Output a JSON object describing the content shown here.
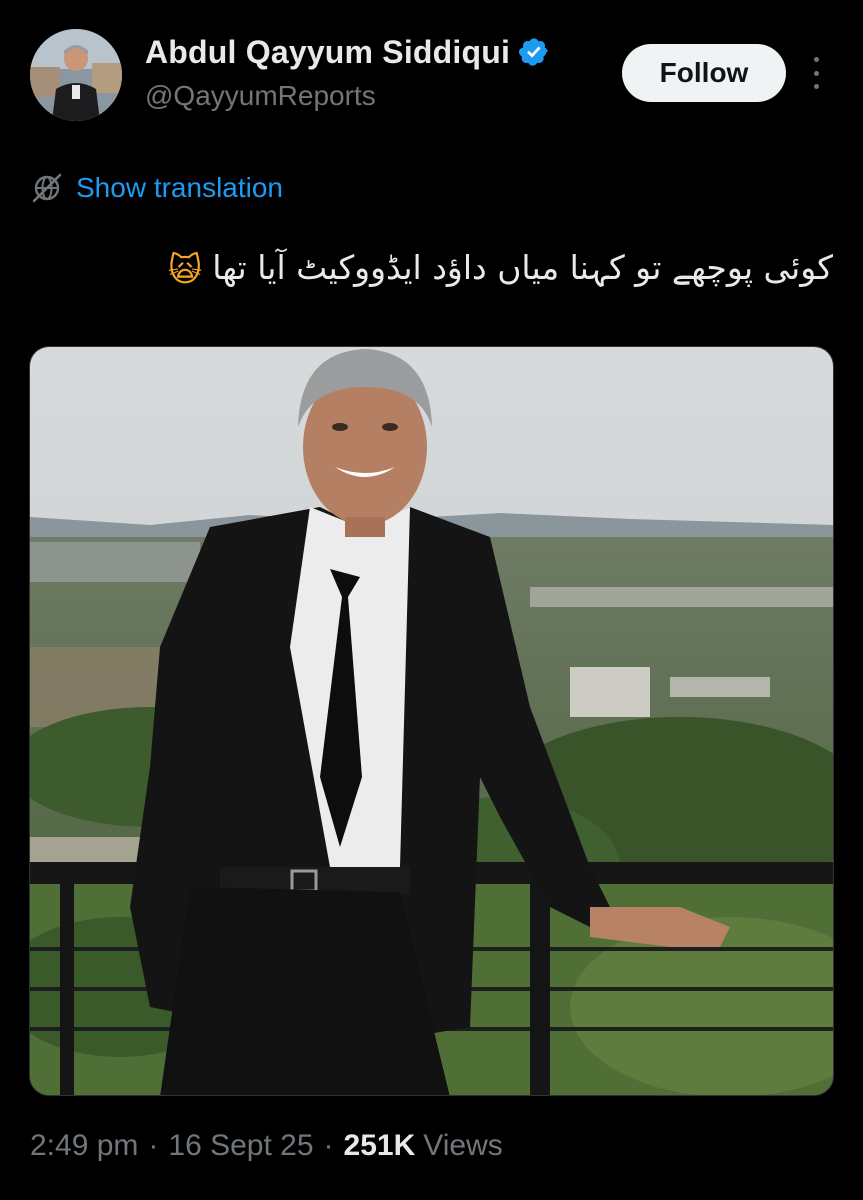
{
  "author": {
    "display_name": "Abdul Qayyum Siddiqui",
    "handle": "@QayyumReports",
    "verified": true
  },
  "actions": {
    "follow_label": "Follow",
    "more_icon": "more-vertical-icon"
  },
  "translation": {
    "label": "Show translation",
    "icon": "globe-slash-icon"
  },
  "tweet": {
    "text": "کوئی پوچھے تو کہنا میاں داؤد ایڈووکیٹ آیا تھا",
    "emoji": "🙀"
  },
  "meta": {
    "time": "2:49 pm",
    "separator": "·",
    "date": "16 Sept 25",
    "views_count": "251K",
    "views_label": "Views"
  },
  "colors": {
    "background": "#000000",
    "text": "#e7e9ea",
    "muted": "#71767b",
    "link": "#1d9bf0",
    "verified": "#1d9bf0",
    "follow_bg": "#eff3f4"
  }
}
